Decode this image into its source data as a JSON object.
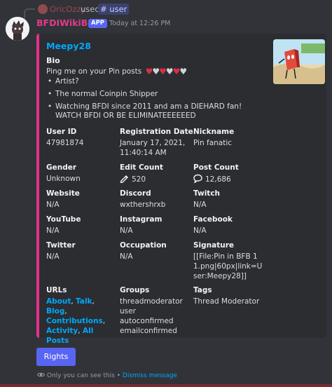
{
  "reply": {
    "user": "OricOzzy",
    "used": "used",
    "command": "# user"
  },
  "bot": {
    "name": "BFDIWikiBot",
    "badge": "APP",
    "timestamp": "Today at 12:26 PM"
  },
  "embed": {
    "accent_color": "#e5308a",
    "title": "Meepy28",
    "bio_heading": "Bio",
    "ping_text": "Ping me on your Pin posts",
    "hearts": [
      "red",
      "white",
      "red",
      "white",
      "red",
      "white"
    ],
    "bio_items": [
      "Artist?",
      "The normal Coinpin Shipper",
      "Watching BFDI since 2011 and am a DIEHARD fan! WATCH BFDI OR BE ELIMINATEEEEEED"
    ],
    "fields": {
      "user_id": {
        "name": "User ID",
        "value": "47981874"
      },
      "registration_date": {
        "name": "Registration Date",
        "value": "January 17, 2021, 11:40:14 AM"
      },
      "nickname": {
        "name": "Nickname",
        "value": "Pin fanatic"
      },
      "gender": {
        "name": "Gender",
        "value": "Unknown"
      },
      "edit_count": {
        "name": "Edit Count",
        "value": "520",
        "icon": "pencil-icon"
      },
      "post_count": {
        "name": "Post Count",
        "value": "12,686",
        "icon": "speech-bubble-icon"
      },
      "website": {
        "name": "Website",
        "value": "N/A"
      },
      "discord": {
        "name": "Discord",
        "value": "wxthershrxb"
      },
      "twitch": {
        "name": "Twitch",
        "value": "N/A"
      },
      "youtube": {
        "name": "YouTube",
        "value": "N/A"
      },
      "instagram": {
        "name": "Instagram",
        "value": "N/A"
      },
      "facebook": {
        "name": "Facebook",
        "value": "N/A"
      },
      "twitter": {
        "name": "Twitter",
        "value": "N/A"
      },
      "occupation": {
        "name": "Occupation",
        "value": "N/A"
      },
      "signature": {
        "name": "Signature",
        "value": "[[File:Pin in BFB 11.png|60px|link=User:Meepy28]]"
      },
      "urls": {
        "name": "URLs",
        "links": [
          "About",
          "Talk",
          "Blog",
          "Contributions",
          "Activity",
          "All Posts"
        ]
      },
      "groups": {
        "name": "Groups",
        "values": [
          "threadmoderator",
          "user",
          "autoconfirmed",
          "emailconfirmed"
        ]
      },
      "tags": {
        "name": "Tags",
        "value": "Thread Moderator"
      }
    }
  },
  "buttons": {
    "rights": "Rights"
  },
  "ephemeral": {
    "notice": "Only you can see this",
    "separator": "•",
    "dismiss": "Dismiss message"
  }
}
